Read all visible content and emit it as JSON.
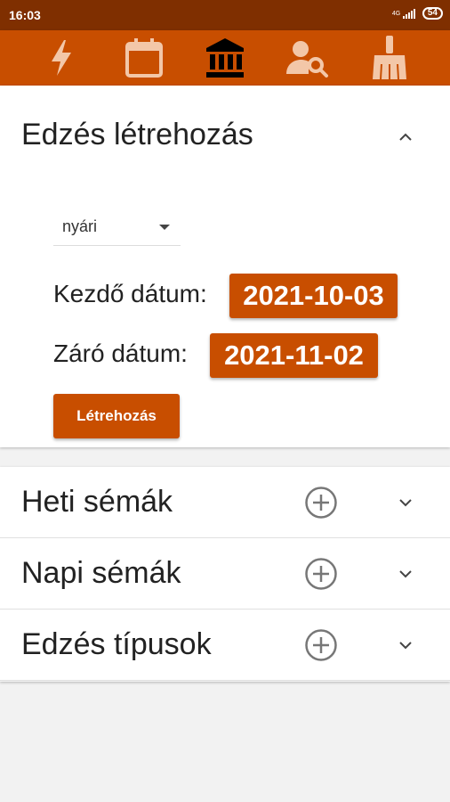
{
  "status_bar": {
    "time": "16:03",
    "network": "4G",
    "battery": "54"
  },
  "nav": {
    "items": [
      {
        "icon": "lightning-icon",
        "active": false
      },
      {
        "icon": "calendar-icon",
        "active": false
      },
      {
        "icon": "bank-icon",
        "active": true
      },
      {
        "icon": "person-search-icon",
        "active": false
      },
      {
        "icon": "broom-icon",
        "active": false
      }
    ]
  },
  "create_workout": {
    "title": "Edzés létrehozás",
    "season_select": "nyári",
    "start_label": "Kezdő dátum:",
    "start_date": "2021-10-03",
    "end_label": "Záró dátum:",
    "end_date": "2021-11-02",
    "create_button": "Létrehozás"
  },
  "sections": [
    {
      "label": "Heti sémák"
    },
    {
      "label": "Napi sémák"
    },
    {
      "label": "Edzés típusok"
    }
  ],
  "colors": {
    "accent": "#c84e00",
    "status_bar": "#7f2f00",
    "inactive_icon": "#f3c7a8",
    "active_icon": "#000000"
  }
}
